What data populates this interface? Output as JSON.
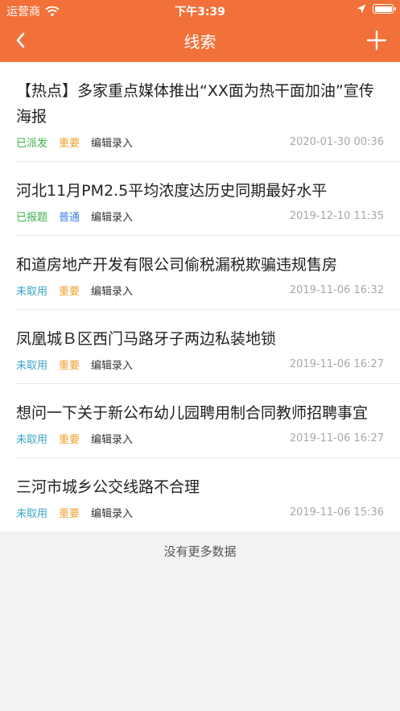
{
  "status_bar": {
    "carrier": "运营商",
    "time": "下午3:39"
  },
  "nav": {
    "title": "线索"
  },
  "items": [
    {
      "title": "【热点】多家重点媒体推出“XX面为热干面加油”宣传海报",
      "status": "已派发",
      "priority": "重要",
      "source": "编辑录入",
      "date": "2020-01-30 00:36"
    },
    {
      "title": "河北11月PM2.5平均浓度达历史同期最好水平",
      "status": "已报题",
      "priority": "普通",
      "source": "编辑录入",
      "date": "2019-12-10 11:35"
    },
    {
      "title": "和道房地产开发有限公司偷税漏税欺骗违规售房",
      "status": "未取用",
      "priority": "重要",
      "source": "编辑录入",
      "date": "2019-11-06 16:32"
    },
    {
      "title": "凤凰城Ｂ区西门马路牙子两边私装地锁",
      "status": "未取用",
      "priority": "重要",
      "source": "编辑录入",
      "date": "2019-11-06 16:27"
    },
    {
      "title": "想问一下关于新公布幼儿园聘用制合同教师招聘事宜",
      "status": "未取用",
      "priority": "重要",
      "source": "编辑录入",
      "date": "2019-11-06 16:27"
    },
    {
      "title": "三河市城乡公交线路不合理",
      "status": "未取用",
      "priority": "重要",
      "source": "编辑录入",
      "date": "2019-11-06 15:36"
    }
  ],
  "footer": {
    "no_more": "没有更多数据"
  },
  "colors": {
    "header": "#f27039",
    "status_dispatched": "#3bb14a",
    "status_reported": "#3bb14a",
    "status_unused": "#3aa6c8",
    "priority_important": "#f0a030",
    "priority_normal": "#3a7ee8"
  }
}
